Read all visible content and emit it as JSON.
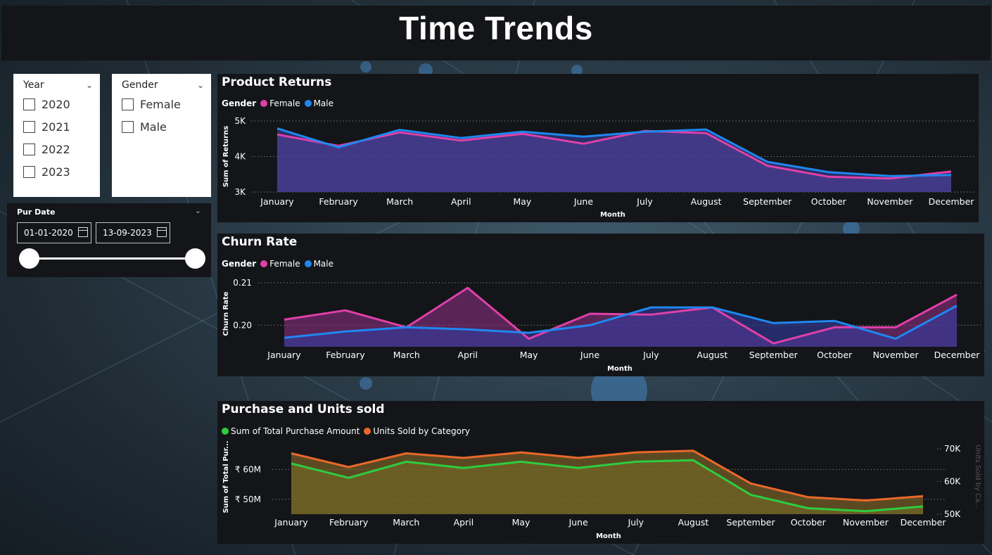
{
  "page": {
    "title": "Time Trends"
  },
  "filters": {
    "year": {
      "title": "Year",
      "options": [
        "2020",
        "2021",
        "2022",
        "2023"
      ]
    },
    "gender": {
      "title": "Gender",
      "options": [
        "Female",
        "Male"
      ]
    },
    "pur_date": {
      "title": "Pur Date",
      "start": "01-01-2020",
      "end": "13-09-2023"
    }
  },
  "colors": {
    "female": "#e040a8",
    "male": "#1e88f0",
    "purchase": "#2ecc40",
    "units": "#e8682a",
    "panel": "#131518"
  },
  "chart_data": [
    {
      "id": "product_returns",
      "type": "area",
      "title": "Product Returns",
      "legend_title": "Gender",
      "xlabel": "Month",
      "ylabel": "Sum of Returns",
      "categories": [
        "January",
        "February",
        "March",
        "April",
        "May",
        "June",
        "July",
        "August",
        "September",
        "October",
        "November",
        "December"
      ],
      "ylim": [
        3000,
        5000
      ],
      "yticks": [
        "3K",
        "4K",
        "5K"
      ],
      "series": [
        {
          "name": "Female",
          "color": "#e040a8",
          "values": [
            4620,
            4300,
            4680,
            4450,
            4640,
            4360,
            4720,
            4660,
            3740,
            3430,
            3380,
            3580
          ]
        },
        {
          "name": "Male",
          "color": "#1e88f0",
          "values": [
            4790,
            4260,
            4750,
            4520,
            4700,
            4560,
            4700,
            4760,
            3850,
            3560,
            3450,
            3480
          ]
        }
      ]
    },
    {
      "id": "churn_rate",
      "type": "area",
      "title": "Churn Rate",
      "legend_title": "Gender",
      "xlabel": "Month",
      "ylabel": "Churn Rate",
      "categories": [
        "January",
        "February",
        "March",
        "April",
        "May",
        "June",
        "July",
        "August",
        "September",
        "October",
        "November",
        "December"
      ],
      "ylim": [
        0.1949,
        0.2105
      ],
      "yticks": [
        "0.20",
        "0.21"
      ],
      "series": [
        {
          "name": "Female",
          "color": "#e040a8",
          "values": [
            0.2013,
            0.2035,
            0.1995,
            0.2088,
            0.1968,
            0.2027,
            0.2025,
            0.2042,
            0.1957,
            0.1995,
            0.1995,
            0.2072
          ]
        },
        {
          "name": "Male",
          "color": "#1e88f0",
          "values": [
            0.197,
            0.1985,
            0.1995,
            0.199,
            0.1982,
            0.2,
            0.2042,
            0.2042,
            0.2005,
            0.201,
            0.1968,
            0.2046
          ]
        }
      ]
    },
    {
      "id": "purchase_units",
      "type": "area",
      "title": "Purchase and Units sold",
      "xlabel": "Month",
      "ylabel": "Sum of Total Pur...",
      "y2label": "Units Sold by Ca...",
      "categories": [
        "January",
        "February",
        "March",
        "April",
        "May",
        "June",
        "July",
        "August",
        "September",
        "October",
        "November",
        "December"
      ],
      "ylim": [
        45000000,
        70000000
      ],
      "yticks": [
        "₹ 50M",
        "₹ 60M"
      ],
      "y2lim": [
        50000,
        70000
      ],
      "y2ticks": [
        "50K",
        "60K",
        "70K"
      ],
      "series": [
        {
          "name": "Sum of Total Purchase Amount",
          "color": "#2ecc40",
          "axis": "left",
          "values": [
            62000000,
            57200000,
            62600000,
            60500000,
            62600000,
            60500000,
            62600000,
            63100000,
            51500000,
            47000000,
            46000000,
            47600000
          ]
        },
        {
          "name": "Units Sold by Category",
          "color": "#e8682a",
          "axis": "right",
          "values": [
            68600,
            64400,
            68600,
            67200,
            68900,
            67200,
            68900,
            69400,
            59400,
            55200,
            54200,
            55500
          ]
        }
      ]
    }
  ]
}
